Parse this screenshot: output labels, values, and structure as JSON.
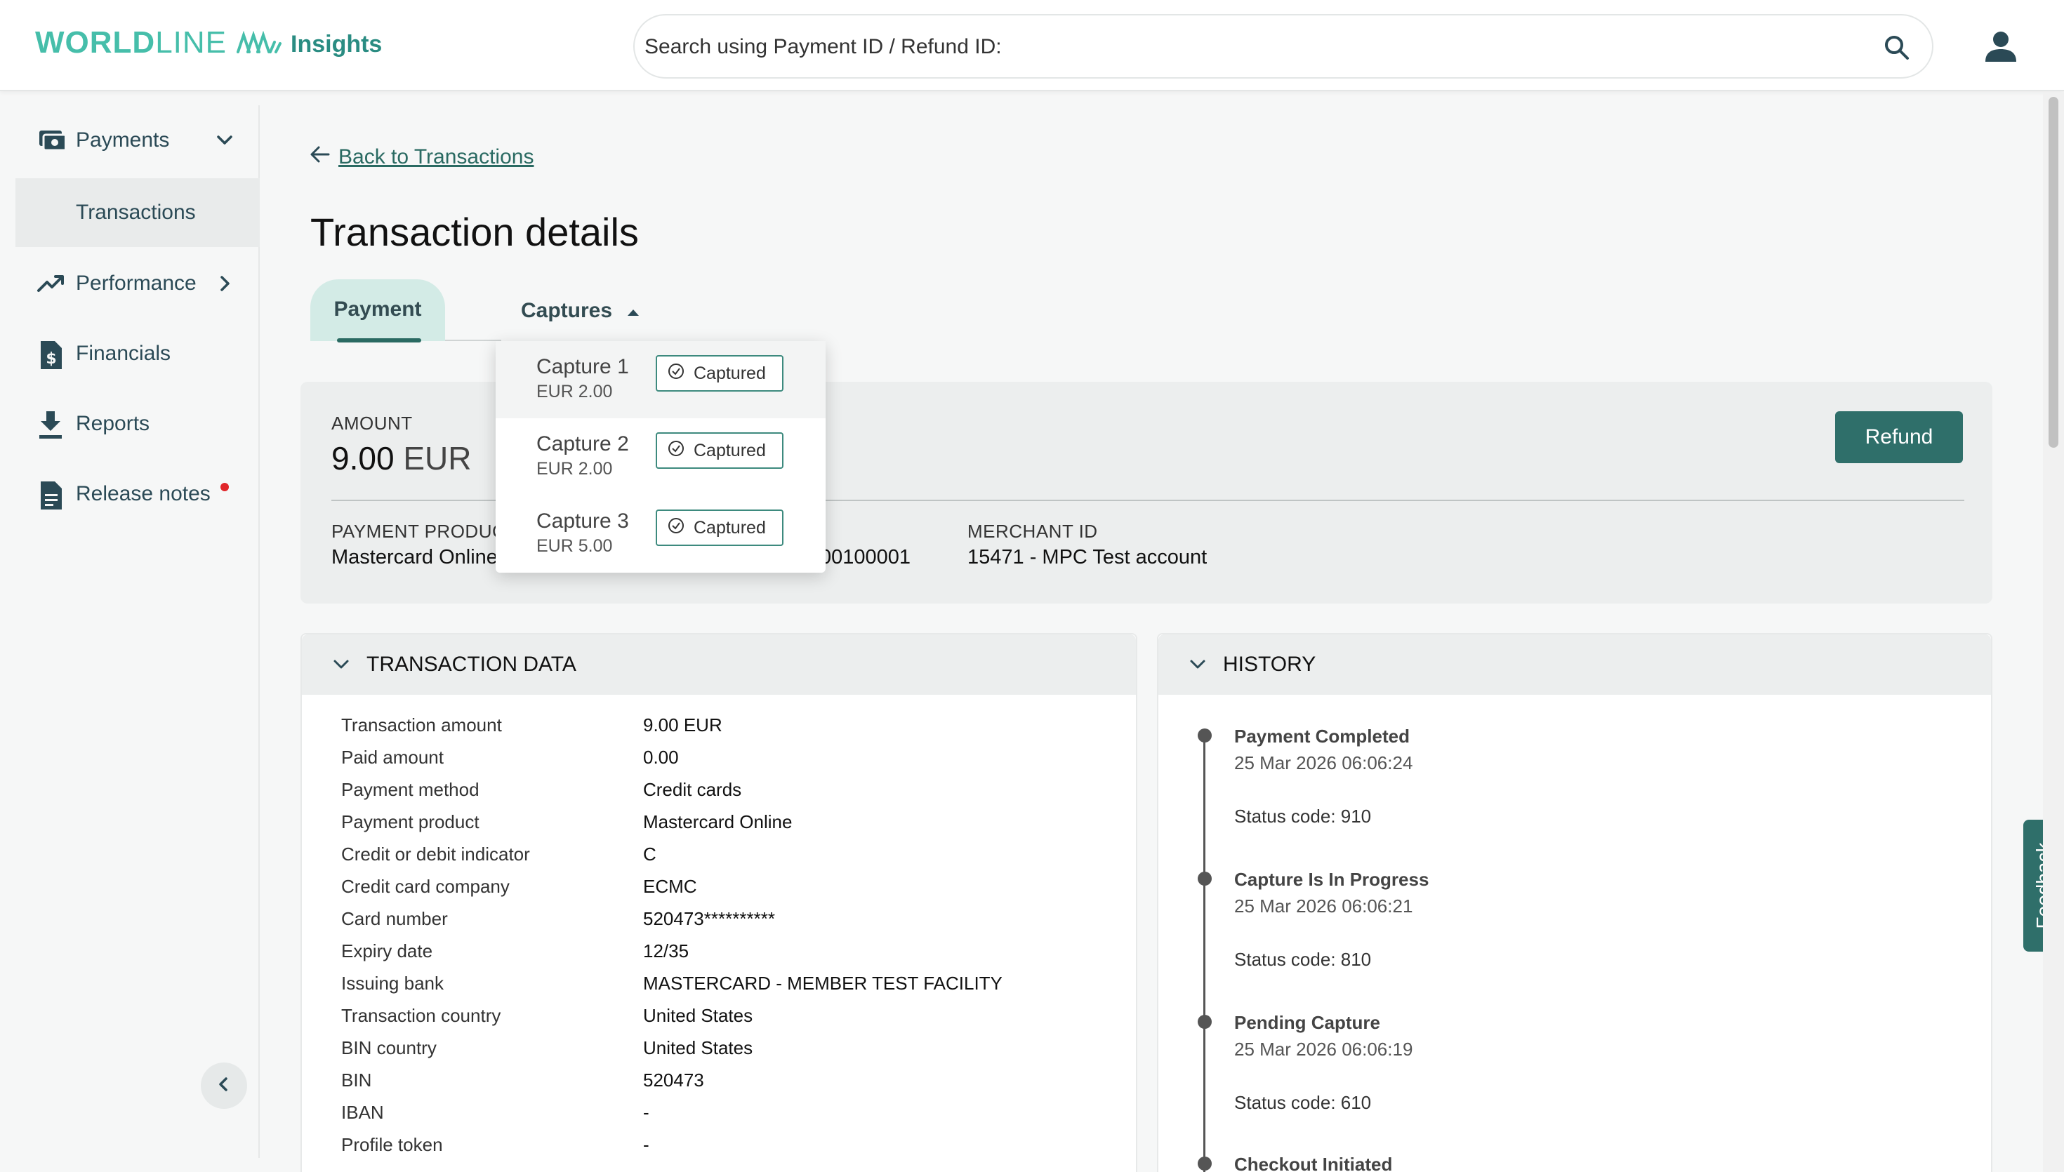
{
  "header": {
    "logo_bold": "WORLD",
    "logo_light": "LINE",
    "app_name": "Insights",
    "search_placeholder": "Search using Payment ID / Refund ID:"
  },
  "sidebar": {
    "items": [
      {
        "label": "Payments",
        "icon": "payments-icon"
      },
      {
        "label": "Transactions"
      },
      {
        "label": "Performance",
        "icon": "performance-icon"
      },
      {
        "label": "Financials",
        "icon": "financials-icon"
      },
      {
        "label": "Reports",
        "icon": "download-icon"
      },
      {
        "label": "Release notes",
        "icon": "document-icon"
      }
    ]
  },
  "main": {
    "back_link": "Back to Transactions",
    "title": "Transaction details",
    "tabs": [
      {
        "label": "Payment"
      },
      {
        "label": "Captures"
      }
    ],
    "summary": {
      "amount_label": "AMOUNT",
      "amount_value": "9.00",
      "amount_currency": "EUR",
      "refund_label": "Refund",
      "payment_product_label": "PAYMENT PRODUCT",
      "payment_product_value": "Mastercard Online",
      "hidden_id_fragment": "00100001",
      "merchant_id_label": "MERCHANT ID",
      "merchant_id_value": "15471 - MPC Test account"
    },
    "captures": [
      {
        "name": "Capture 1",
        "amount": "EUR 2.00",
        "status": "Captured"
      },
      {
        "name": "Capture 2",
        "amount": "EUR 2.00",
        "status": "Captured"
      },
      {
        "name": "Capture 3",
        "amount": "EUR 5.00",
        "status": "Captured"
      }
    ],
    "transaction_data": {
      "title": "TRANSACTION DATA",
      "rows": [
        {
          "k": "Transaction amount",
          "v": "9.00 EUR"
        },
        {
          "k": "Paid amount",
          "v": "0.00"
        },
        {
          "k": "Payment method",
          "v": "Credit cards"
        },
        {
          "k": "Payment product",
          "v": "Mastercard Online"
        },
        {
          "k": "Credit or debit indicator",
          "v": "C"
        },
        {
          "k": "Credit card company",
          "v": "ECMC"
        },
        {
          "k": "Card number",
          "v": "520473**********"
        },
        {
          "k": "Expiry date",
          "v": "12/35"
        },
        {
          "k": "Issuing bank",
          "v": "MASTERCARD - MEMBER TEST FACILITY"
        },
        {
          "k": "Transaction country",
          "v": "United States"
        },
        {
          "k": "BIN country",
          "v": "United States"
        },
        {
          "k": "BIN",
          "v": "520473"
        },
        {
          "k": "IBAN",
          "v": "-"
        },
        {
          "k": "Profile token",
          "v": "-"
        }
      ]
    },
    "history": {
      "title": "HISTORY",
      "events": [
        {
          "title": "Payment Completed",
          "date": "25 Mar 2026 06:06:24",
          "status": "Status code: 910"
        },
        {
          "title": "Capture Is In Progress",
          "date": "25 Mar 2026 06:06:21",
          "status": "Status code: 810"
        },
        {
          "title": "Pending Capture",
          "date": "25 Mar 2026 06:06:19",
          "status": "Status code: 610"
        },
        {
          "title": "Checkout Initiated"
        }
      ]
    }
  },
  "feedback_label": "Feedback",
  "colors": {
    "brand": "#46beaa",
    "accent": "#2f6f6a",
    "notification": "#e0262a"
  }
}
